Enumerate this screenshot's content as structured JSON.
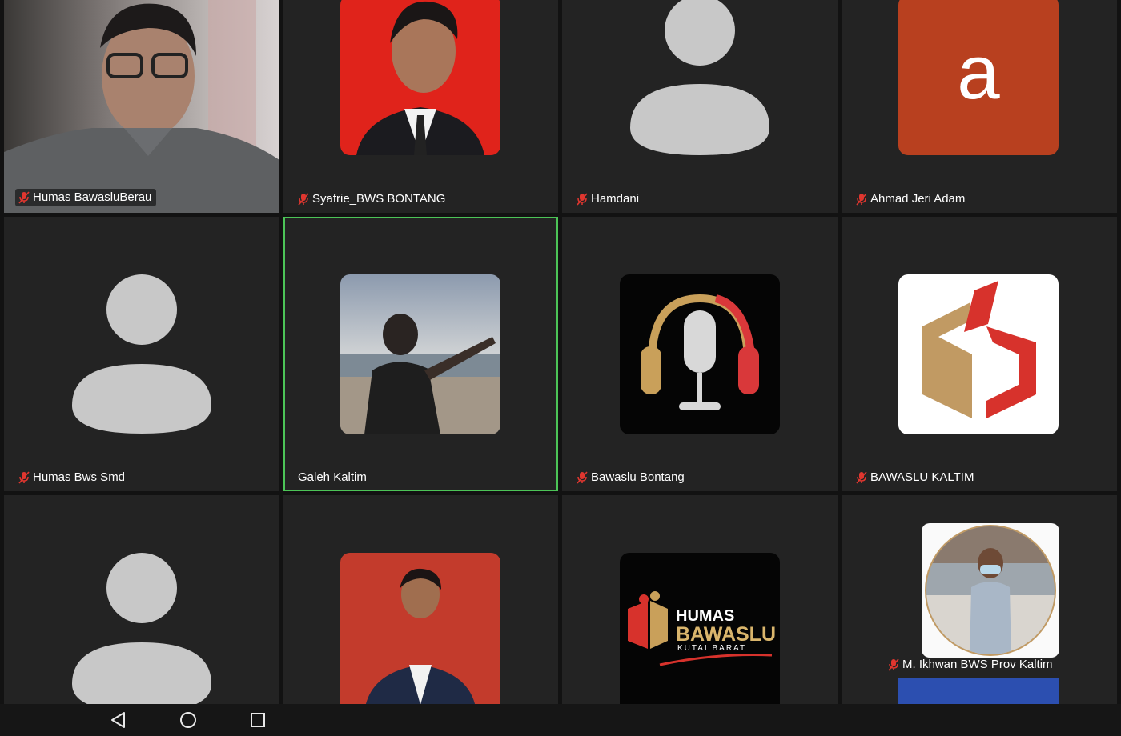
{
  "participants": [
    {
      "name": "Humas BawasluBerau",
      "muted": true
    },
    {
      "name": "Syafrie_BWS BONTANG",
      "muted": true
    },
    {
      "name": "Hamdani",
      "muted": true
    },
    {
      "name": "Ahmad Jeri Adam",
      "muted": true
    },
    {
      "name": "Humas Bws Smd",
      "muted": true
    },
    {
      "name": "Galeh Kaltim",
      "muted": false
    },
    {
      "name": "Bawaslu Bontang",
      "muted": true
    },
    {
      "name": "BAWASLU KALTIM",
      "muted": true
    },
    {
      "name": "",
      "muted": false
    },
    {
      "name": "",
      "muted": false
    },
    {
      "name": "",
      "muted": false
    },
    {
      "name": "M. Ikhwan BWS Prov Kaltim",
      "muted": true
    }
  ],
  "avatar_letter": "a",
  "humas_logo": {
    "line1": "HUMAS",
    "line2": "BAWASLU",
    "line3": "KUTAI BARAT"
  },
  "colors": {
    "active_speaker": "#4cc457",
    "tile_bg": "#232323",
    "muted_icon": "#e0362f"
  },
  "icons": {
    "mute": "mic-off-icon",
    "nav_back": "nav-back-icon",
    "nav_home": "nav-home-icon",
    "nav_recents": "nav-recents-icon"
  }
}
